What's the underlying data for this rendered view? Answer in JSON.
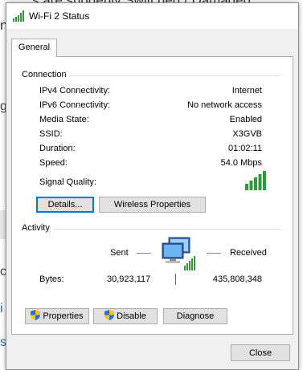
{
  "background": {
    "line1": "s are suddenly Switched / Damaged",
    "line2": "n",
    "fragments": [
      "g",
      "r",
      "c",
      "i",
      "s"
    ]
  },
  "window": {
    "title": "Wi-Fi 2 Status",
    "tabs": [
      {
        "label": "General"
      }
    ]
  },
  "connection": {
    "heading": "Connection",
    "rows": [
      {
        "label": "IPv4 Connectivity:",
        "value": "Internet"
      },
      {
        "label": "IPv6 Connectivity:",
        "value": "No network access"
      },
      {
        "label": "Media State:",
        "value": "Enabled"
      },
      {
        "label": "SSID:",
        "value": "X3GVB"
      },
      {
        "label": "Duration:",
        "value": "01:02:11"
      },
      {
        "label": "Speed:",
        "value": "54.0 Mbps"
      }
    ],
    "signal_quality_label": "Signal Quality:",
    "signal_bars_filled": 5,
    "signal_bars_total": 5,
    "details_button": "Details...",
    "wireless_properties_button": "Wireless Properties"
  },
  "activity": {
    "heading": "Activity",
    "sent_label": "Sent",
    "received_label": "Received",
    "bytes_label": "Bytes:",
    "bytes_sent": "30,923,117",
    "bytes_received": "435,808,348"
  },
  "actions": {
    "properties_button": "Properties",
    "disable_button": "Disable",
    "diagnose_button": "Diagnose"
  },
  "footer": {
    "close_button": "Close"
  },
  "colors": {
    "signal_green": "#2f9a3c",
    "focus_blue": "#0078d7",
    "shield_blue": "#2a6fd6",
    "shield_yellow": "#f3c519"
  },
  "icons": {
    "title": "wifi-signal-icon",
    "network": "network-computers-icon",
    "shield": "uac-shield-icon"
  }
}
